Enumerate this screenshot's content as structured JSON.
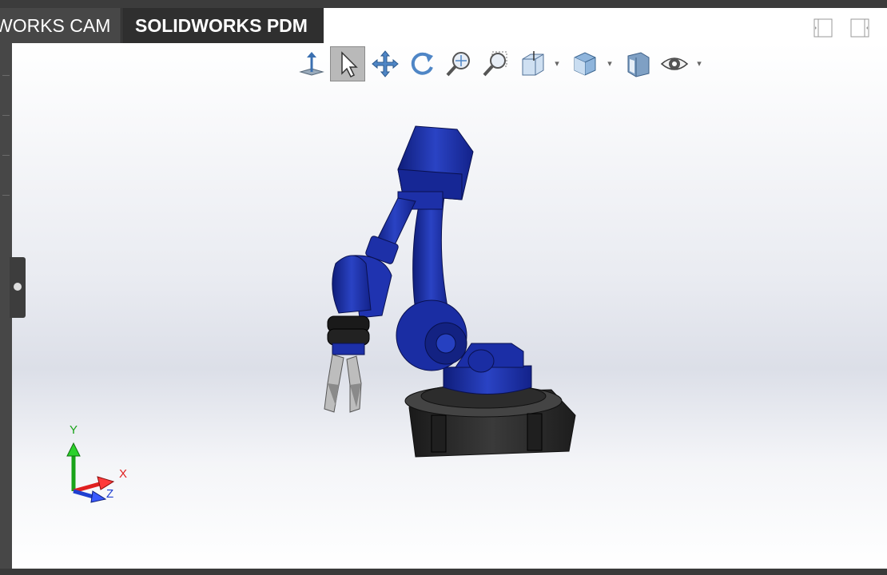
{
  "tabs": [
    {
      "label": "WORKS CAM",
      "active": false
    },
    {
      "label": "SOLIDWORKS PDM",
      "active": true
    }
  ],
  "heads_up_toolbar": [
    {
      "icon": "normal-to-icon"
    },
    {
      "icon": "select-arrow-icon",
      "active": true
    },
    {
      "icon": "pan-icon"
    },
    {
      "icon": "rotate-icon"
    },
    {
      "icon": "zoom-to-fit-icon"
    },
    {
      "icon": "zoom-to-area-icon"
    },
    {
      "icon": "section-view-icon",
      "dropdown": true
    },
    {
      "icon": "view-orientation-icon",
      "dropdown": true
    },
    {
      "icon": "display-style-icon"
    },
    {
      "icon": "hide-show-icon",
      "dropdown": true
    }
  ],
  "triad": {
    "x_label": "X",
    "y_label": "Y",
    "z_label": "Z"
  },
  "colors": {
    "robot": "#1e2f9c",
    "base": "#2b2b2b",
    "x_axis": "#e02020",
    "y_axis": "#19a319",
    "z_axis": "#2040d0"
  }
}
